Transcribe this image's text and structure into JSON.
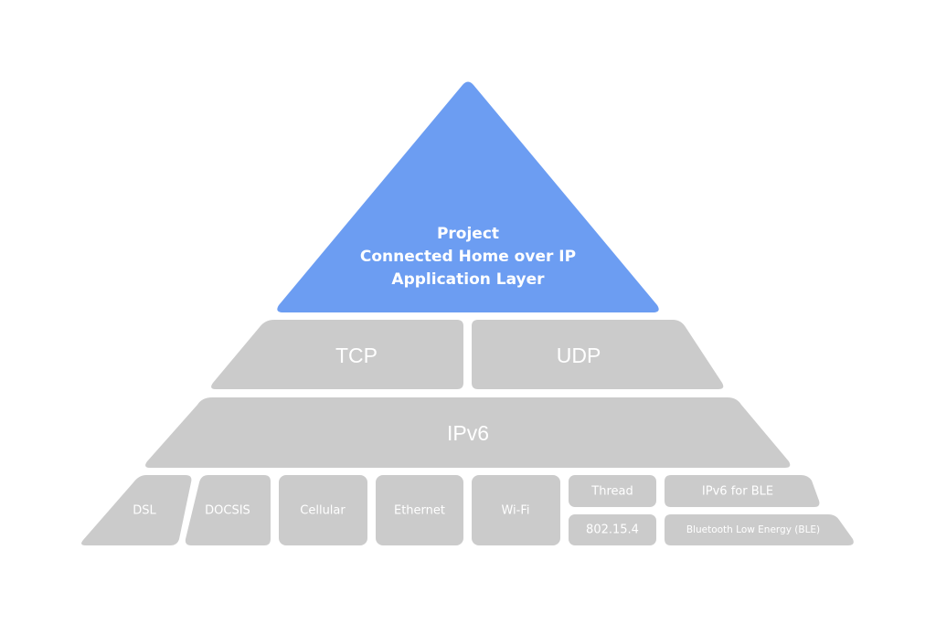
{
  "colors": {
    "application_layer": "#6c9df2",
    "layer_block": "#cbcbcb",
    "label_text": "#ffffff",
    "background": "#ffffff"
  },
  "application_layer": {
    "lines": [
      "Project",
      "Connected Home over IP",
      "Application Layer"
    ]
  },
  "transport_layer": {
    "blocks": [
      {
        "label": "TCP"
      },
      {
        "label": "UDP"
      }
    ]
  },
  "network_layer": {
    "label": "IPv6"
  },
  "link_layer": {
    "blocks": [
      {
        "label": "DSL"
      },
      {
        "label": "DOCSIS"
      },
      {
        "label": "Cellular"
      },
      {
        "label": "Ethernet"
      },
      {
        "label": "Wi-Fi"
      }
    ],
    "thread_stack": {
      "upper": {
        "label": "Thread"
      },
      "lower": {
        "label": "802.15.4"
      }
    },
    "ble_stack": {
      "upper": {
        "label": "IPv6 for BLE"
      },
      "lower": {
        "label": "Bluetooth Low Energy (BLE)"
      }
    }
  }
}
